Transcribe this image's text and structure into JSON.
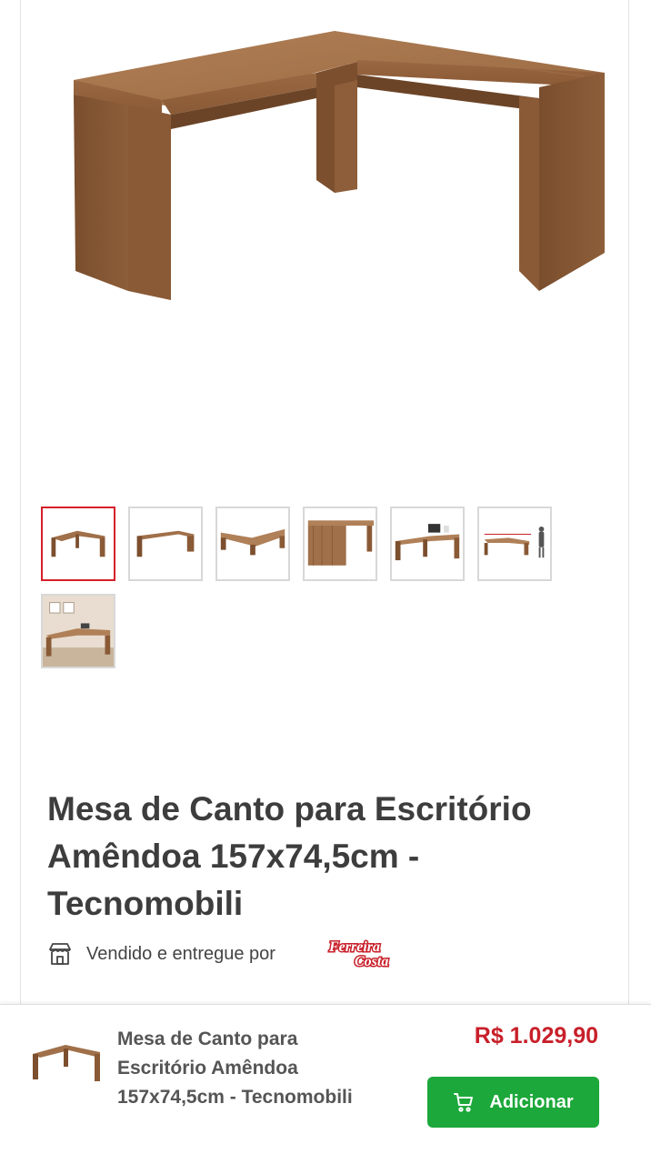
{
  "product": {
    "title": "Mesa de Canto para Escritório Amêndoa 157x74,5cm - Tecnomobili",
    "image_alt": "Mesa de canto em L, acabamento amêndoa",
    "selected_thumbnail": 1
  },
  "gallery": {
    "thumbnails": [
      {
        "icon": "l-desk-angle-1"
      },
      {
        "icon": "l-desk-angle-2"
      },
      {
        "icon": "l-desk-top-view"
      },
      {
        "icon": "l-desk-side-view"
      },
      {
        "icon": "l-desk-with-laptop"
      },
      {
        "icon": "l-desk-dimensions"
      },
      {
        "icon": "l-desk-in-room"
      }
    ]
  },
  "seller": {
    "label": "Vendido e entregue por",
    "logo_text_line1": "Ferreira",
    "logo_text_line2": "Costa"
  },
  "bottom_bar": {
    "title": "Mesa de Canto para Escritório Amêndoa 157x74,5cm - Tecnomobili",
    "price": "R$ 1.029,90",
    "add_label": "Adicionar"
  },
  "colors": {
    "accent_red": "#c8202a",
    "button_green": "#1ca83a",
    "wood": "#a0704a"
  }
}
